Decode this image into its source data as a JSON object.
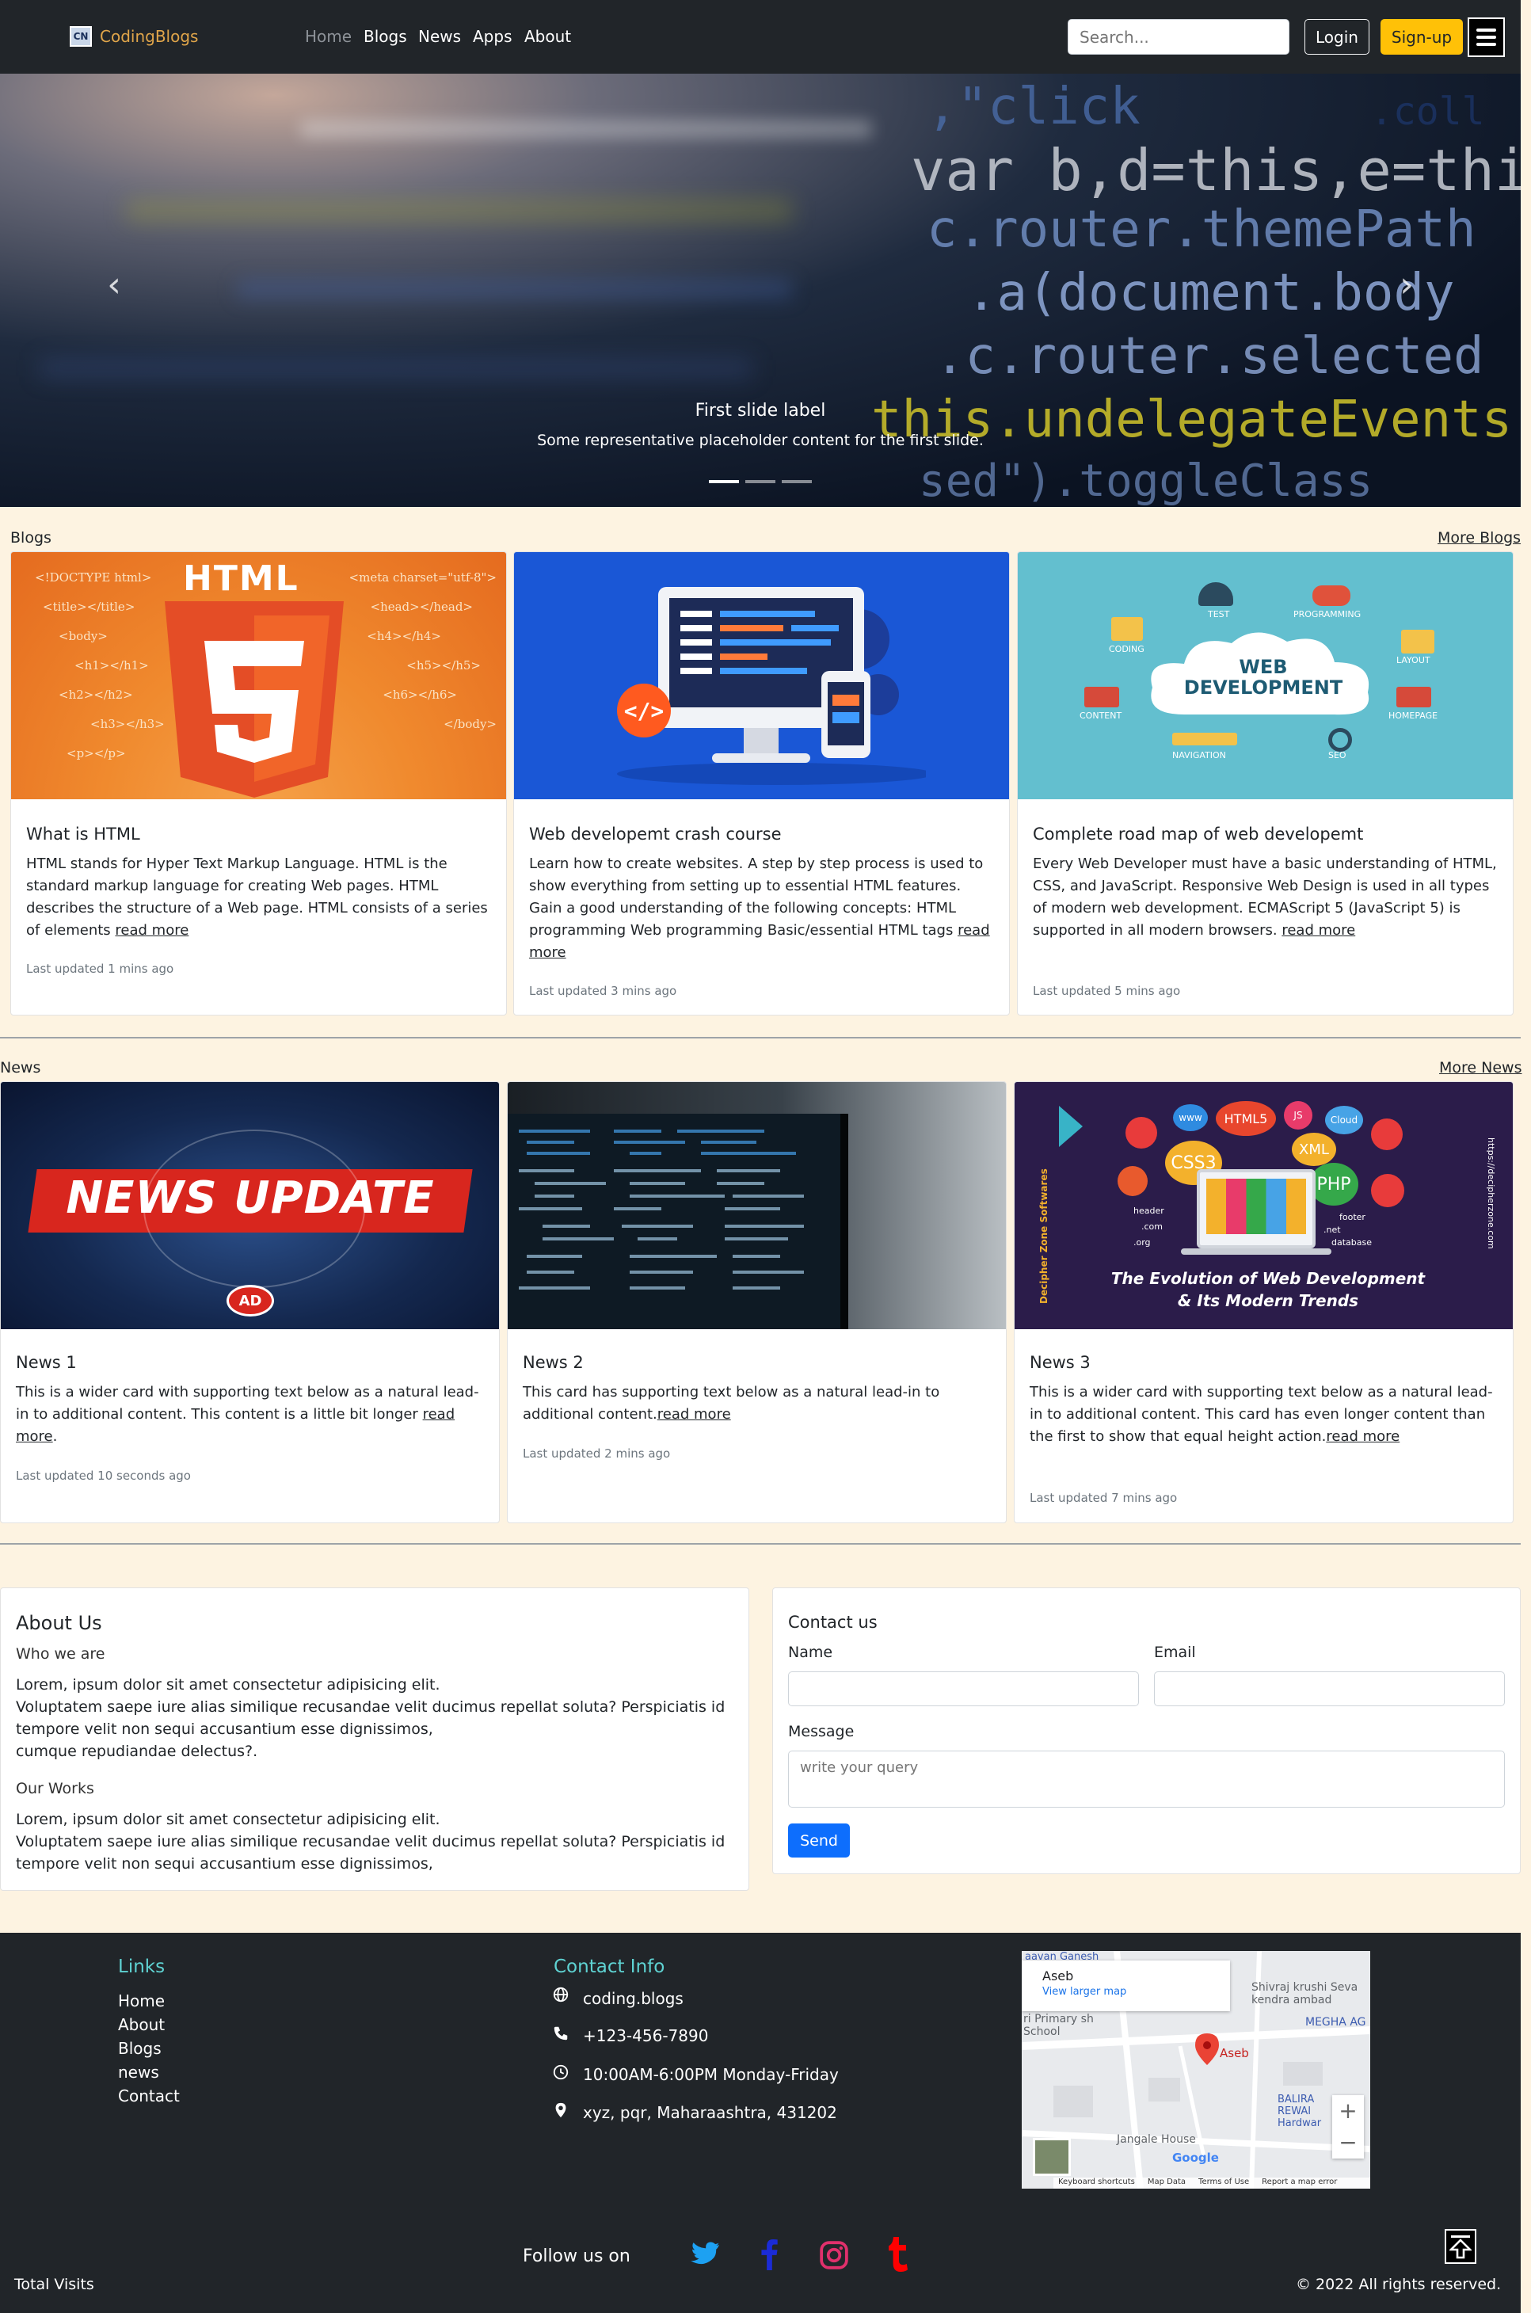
{
  "brand": {
    "name": "CodingBlogs",
    "logo_text": "CN"
  },
  "nav": {
    "links": [
      "Home",
      "Blogs",
      "News",
      "Apps",
      "About"
    ]
  },
  "search": {
    "placeholder": "Search..."
  },
  "auth": {
    "login": "Login",
    "signup": "Sign-up"
  },
  "carousel": {
    "caption_title": "First slide label",
    "caption_text": "Some representative placeholder content for the first slide.",
    "code_lines": [
      ",\"click",
      ".coll",
      "var b,d=this,e=this",
      "c.router.themePath",
      ".a(document.body",
      ".c.router.selected",
      "this.undelegateEvents",
      "sed\").toggleClass"
    ]
  },
  "blogs": {
    "label": "Blogs",
    "more": "More Blogs",
    "cards": [
      {
        "title": "What is HTML",
        "text": "HTML stands for Hyper Text Markup Language. HTML is the standard markup language for creating Web pages. HTML describes the structure of a Web page. HTML consists of a series of elements",
        "link": "read more",
        "updated": "Last updated 1 mins ago"
      },
      {
        "title": "Web developemt crash course",
        "text": "Learn how to create websites. A step by step process is used to show everything from setting up to essential HTML features. Gain a good understanding of the following concepts: HTML programming Web programming Basic/essential HTML tags",
        "link": "read more",
        "updated": "Last updated 3 mins ago"
      },
      {
        "title": "Complete road map of web developemt",
        "text": "Every Web Developer must have a basic understanding of HTML, CSS, and JavaScript. Responsive Web Design is used in all types of modern web development. ECMAScript 5 (JavaScript 5) is supported in all modern browsers.",
        "link": "read more",
        "updated": "Last updated 5 mins ago"
      }
    ],
    "html_img": {
      "title": "HTML",
      "tags_left": [
        "<!DOCTYPE html>",
        "<title></title>",
        "<body>",
        "<h1></h1>",
        "<h2></h2>",
        "<h3></h3>",
        "<p></p>"
      ],
      "tags_right": [
        "<meta charset=\"utf-8\">",
        "<head></head>",
        "<h4></h4>",
        "<h5></h5>",
        "<h6></h6>",
        "</body>"
      ]
    },
    "webdev_img": {
      "title": "WEB DEVELOPMENT",
      "labels": [
        "TEST",
        "PROGRAMMING",
        "CODING",
        "LAYOUT",
        "CONTENT",
        "HOMEPAGE",
        "NAVIGATION",
        "SEO"
      ]
    }
  },
  "news": {
    "label": "News",
    "more": "More News",
    "cards": [
      {
        "title": "News 1",
        "text": "This is a wider card with supporting text below as a natural lead-in to additional content. This content is a little bit longer",
        "link": "read more",
        "after": ".",
        "updated": "Last updated 10 seconds ago"
      },
      {
        "title": "News 2",
        "text": "This card has supporting text below as a natural lead-in to additional content.",
        "link": "read more",
        "after": "",
        "updated": "Last updated 2 mins ago"
      },
      {
        "title": "News 3",
        "text": "This is a wider card with supporting text below as a natural lead-in to additional content. This card has even longer content than the first to show that equal height action.",
        "link": "read more",
        "after": "",
        "updated": "Last updated 7 mins ago"
      }
    ],
    "news_img": {
      "banner": "NEWS UPDATE",
      "badge": "AD"
    },
    "evo_img": {
      "caption": "The Evolution of Web Development & Its Modern Trends",
      "side_left": "Decipher Zone Softwares",
      "side_right": "https://decipherzone.com",
      "tags": [
        "www",
        "HTML5",
        "JS",
        "Cloud",
        "CSS3",
        "XML",
        "PHP",
        "header",
        ".com",
        ".org",
        ".net",
        "footer",
        "database"
      ]
    }
  },
  "about": {
    "title": "About Us",
    "who_heading": "Who we are",
    "who_text": [
      "Lorem, ipsum dolor sit amet consectetur adipisicing elit.",
      "Voluptatem saepe iure alias similique recusandae velit ducimus repellat soluta? Perspiciatis id tempore velit non sequi accusantium esse dignissimos,",
      "cumque repudiandae delectus?."
    ],
    "works_heading": "Our Works",
    "works_text": [
      "Lorem, ipsum dolor sit amet consectetur adipisicing elit.",
      "Voluptatem saepe iure alias similique recusandae velit ducimus repellat soluta? Perspiciatis id tempore velit non sequi accusantium esse dignissimos,"
    ]
  },
  "contact": {
    "title": "Contact us",
    "name_label": "Name",
    "email_label": "Email",
    "message_label": "Message",
    "message_placeholder": "write your query",
    "send": "Send"
  },
  "footer": {
    "links_heading": "Links",
    "links": [
      "Home",
      "About",
      "Blogs",
      "news",
      "Contact"
    ],
    "contact_heading": "Contact Info",
    "website": "coding.blogs",
    "phone": "+123-456-7890",
    "hours": "10:00AM-6:00PM Monday-Friday",
    "address": "xyz, pqr, Maharaashtra, 431202",
    "follow": "Follow us on",
    "total_visits": "Total Visits",
    "copyright": "© 2022 All rights reserved.",
    "map": {
      "place": "Aseb",
      "larger_map": "View larger map",
      "labels": [
        "aavan Ganesh",
        "Shivraj krushi Seva kendra ambad",
        "ri Primary sh School",
        "MEGHA AG",
        "BALIRA REWAI Hardwar",
        "Jangale House",
        "Google"
      ],
      "bottom": [
        "Keyboard shortcuts",
        "Map Data",
        "Terms of Use",
        "Report a map error"
      ]
    },
    "social": {
      "twitter": "#1da1f2",
      "facebook": "#1b2bd6",
      "instagram": "#e1306c",
      "tumblr": "#ff0000"
    }
  }
}
